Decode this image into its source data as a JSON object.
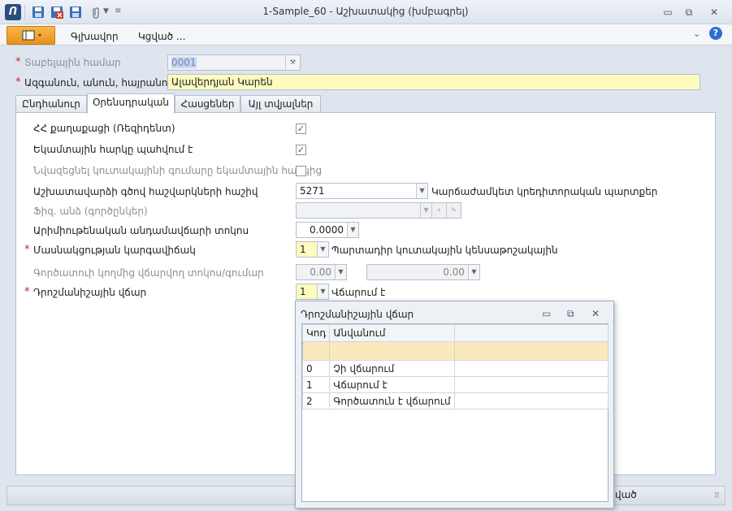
{
  "window": {
    "title": "1-Sample_60 - Աշխատակից (խմբագրել)",
    "minimize": "▭",
    "restore": "⧉",
    "close": "✕"
  },
  "ribbon": {
    "tabs": [
      "Գլխավոր",
      "Կցված ..."
    ],
    "help": "?"
  },
  "header": {
    "tab_number_label": "Տաբելային համար",
    "tab_number_value": "0001",
    "name_label": "Ազգանուն, անուն, հայրանուն",
    "name_value": "Ալավերդյան Կարեն"
  },
  "tabs": [
    "Ընդհանուր",
    "Օրենսդրական",
    "Հասցեներ",
    "Այլ տվյալներ"
  ],
  "form": {
    "resident_label": "ՀՀ քաղաքացի (Ռեզիդենտ)",
    "resident_checked": true,
    "pension_label": "Եկամտային հարկը պահվում է",
    "pension_checked": true,
    "reduce_label": "Նվազեցնել կուտակայինի գումարը եկամտային հարկից",
    "reduce_checked": false,
    "account_label": "Աշխատավարձի գծով հաշվարկների հաշիվ",
    "account_value": "5271",
    "account_desc": "Կարճաժամկետ կրեդիտորական պարտքեր",
    "phys_label": "Ֆիզ. անձ (գործընկեր)",
    "phys_value": "",
    "armed_label": "Արիմիութենական անդամավճարի տոկոս",
    "armed_value": "0.0000",
    "part_label": "Մասնակցության կարգավիճակ",
    "part_value": "1",
    "part_desc": "Պարտադիր կուտակային կենսաթոշակային",
    "employer_label": "Գործատուի կողմից վճարվող տոկոս/գումար",
    "employer_pct": "0.00",
    "employer_amount": "0.00",
    "stamp_label": "Դրոշմանիշային վճար",
    "stamp_value": "1",
    "stamp_desc": "Վճարում է"
  },
  "popup": {
    "title": "Դրոշմանիշային վճար",
    "columns": [
      "Կոդ",
      "Անվանում"
    ],
    "rows": [
      {
        "code": "0",
        "name": "Չի վճարում"
      },
      {
        "code": "1",
        "name": "Վճարում է"
      },
      {
        "code": "2",
        "name": "Գործատուն է վճարում"
      }
    ]
  },
  "statusbar": {
    "save_fragment": "ված"
  },
  "colors": {
    "accent": "#e9921a",
    "required": "#d42020",
    "highlight": "#fdfbbe",
    "selection": "#fbe9bd"
  }
}
